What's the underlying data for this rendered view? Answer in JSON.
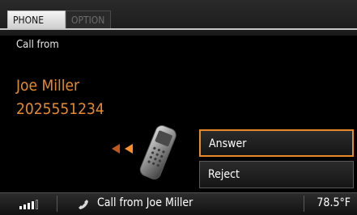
{
  "tabs": [
    {
      "label": "PHONE",
      "active": true
    },
    {
      "label": "OPTION",
      "active": false
    }
  ],
  "call": {
    "header": "Call from",
    "name": "Joe Miller",
    "number": "2025551234"
  },
  "actions": {
    "answer_label": "Answer",
    "reject_label": "Reject"
  },
  "status": {
    "message": "Call from Joe Miller",
    "temperature": "78.5°F",
    "signal_bars": 4
  },
  "colors": {
    "accent": "#e88a2c"
  },
  "icons": {
    "phone": "mobile-phone-icon",
    "status_phone": "handset-icon",
    "signal": "signal-strength-icon",
    "arrows": "incoming-arrow-icon"
  }
}
